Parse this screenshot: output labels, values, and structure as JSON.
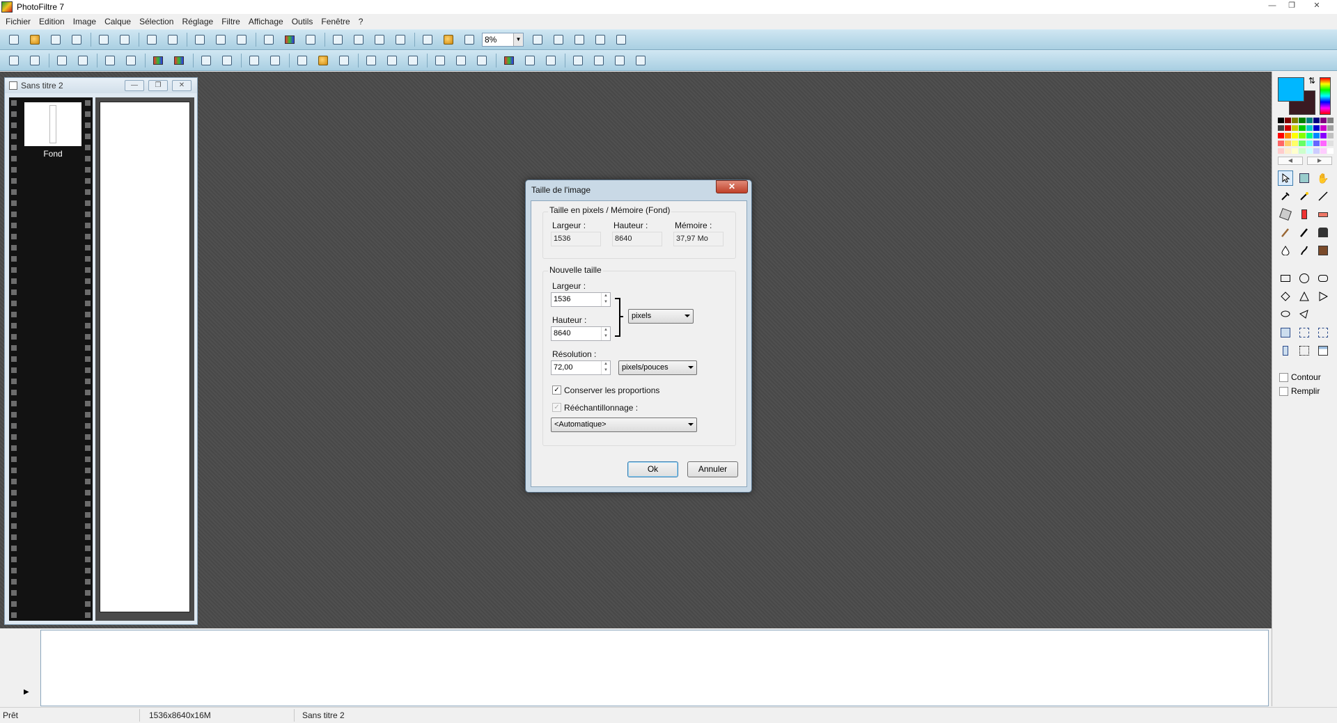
{
  "app": {
    "title": "PhotoFiltre 7",
    "window_buttons": [
      "minimize",
      "restore",
      "close"
    ]
  },
  "menu": [
    "Fichier",
    "Edition",
    "Image",
    "Calque",
    "Sélection",
    "Réglage",
    "Filtre",
    "Affichage",
    "Outils",
    "Fenêtre",
    "?"
  ],
  "toolbar": {
    "zoom_value": "8%"
  },
  "document": {
    "title": "Sans titre 2",
    "layer_name": "Fond"
  },
  "dialog": {
    "title": "Taille de l'image",
    "close_label": "✕",
    "group_current": {
      "title": "Taille en pixels / Mémoire (Fond)",
      "width_label": "Largeur :",
      "height_label": "Hauteur :",
      "memory_label": "Mémoire :",
      "width_value": "1536",
      "height_value": "8640",
      "memory_value": "37,97 Mo"
    },
    "group_new": {
      "title": "Nouvelle taille",
      "width_label": "Largeur :",
      "width_value": "1536",
      "height_label": "Hauteur :",
      "height_value": "8640",
      "unit_value": "pixels",
      "resolution_label": "Résolution :",
      "resolution_value": "72,00",
      "resolution_unit": "pixels/pouces",
      "keep_ratio_label": "Conserver les proportions",
      "keep_ratio_checked": true,
      "resample_label": "Rééchantillonnage :",
      "resample_checked": true,
      "resample_method": "<Automatique>"
    },
    "ok_label": "Ok",
    "cancel_label": "Annuler"
  },
  "toolbox": {
    "foreground_color": "#00b7ff",
    "background_color": "#3a1a22",
    "contour_label": "Contour",
    "fill_label": "Remplir"
  },
  "status": {
    "state": "Prêt",
    "image_info": "1536x8640x16M",
    "document_name": "Sans titre 2"
  }
}
